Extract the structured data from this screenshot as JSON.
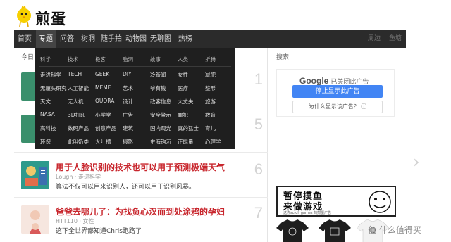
{
  "logo": {
    "text": "煎蛋"
  },
  "nav": {
    "items": [
      "首页",
      "专题",
      "问答",
      "树洞",
      "随手拍",
      "动物园",
      "无聊图",
      "热榜"
    ],
    "right": [
      "周边",
      "鱼塘"
    ]
  },
  "main": {
    "today_label": "今日"
  },
  "dropdown": {
    "headers": [
      "科学",
      "技术",
      "极客",
      "脑洞",
      "故事",
      "人类",
      "折腾"
    ],
    "rows": [
      [
        "走进科学",
        "TECH",
        "GEEK",
        "DIY",
        "冷新闻",
        "女性",
        "减肥"
      ],
      [
        "无厘头研究",
        "人工智能",
        "MEME",
        "艺术",
        "爷有钱",
        "医疗",
        "整形"
      ],
      [
        "天文",
        "无人机",
        "QUORA",
        "设计",
        "政客信息",
        "大丈夫",
        "旅游"
      ],
      [
        "NASA",
        "3D打印",
        "小学堂",
        "广告",
        "安全警示",
        "罪犯",
        "教育"
      ],
      [
        "高科技",
        "数码产品",
        "创意产品",
        "建筑",
        "国内观光",
        "真的猛士",
        "育儿"
      ],
      [
        "环保",
        "此叫奶类",
        "大吐槽",
        "摄影",
        "史海钩沉",
        "正能量",
        "心理学"
      ]
    ]
  },
  "articles": [
    {
      "rank": "1"
    },
    {
      "rank": "5"
    },
    {
      "rank": "6",
      "title": "用于人脸识别的技术也可以用于预测极端天气",
      "meta": "Lough · 走进科学",
      "excerpt": "算法不仅可以用来识别人，还可以用于识别风暴。"
    },
    {
      "rank": "7",
      "title": "爸爸去哪儿了：为找负心汉而到处涂鸦的孕妇",
      "meta": "HTT110 · 女性",
      "excerpt": "这下全世界都知道Chris跑路了"
    }
  ],
  "sidebar": {
    "search_label": "搜索",
    "ad": {
      "google": "Google",
      "closed_text": "已关闭此广告",
      "stop_label": "停止显示此广告",
      "why_label": "为什么显示该广告？ ⓘ"
    },
    "banner": {
      "line1": "暂停摸鱼",
      "line2": "来做游戏",
      "line3": "送你scroll games 的煎蛋广告"
    }
  },
  "watermark": {
    "text": "值 什么值得买"
  },
  "colors": {
    "nav_bg": "#2b2b2b",
    "title_red": "#c8262d",
    "google_blue": "#4285f4"
  }
}
